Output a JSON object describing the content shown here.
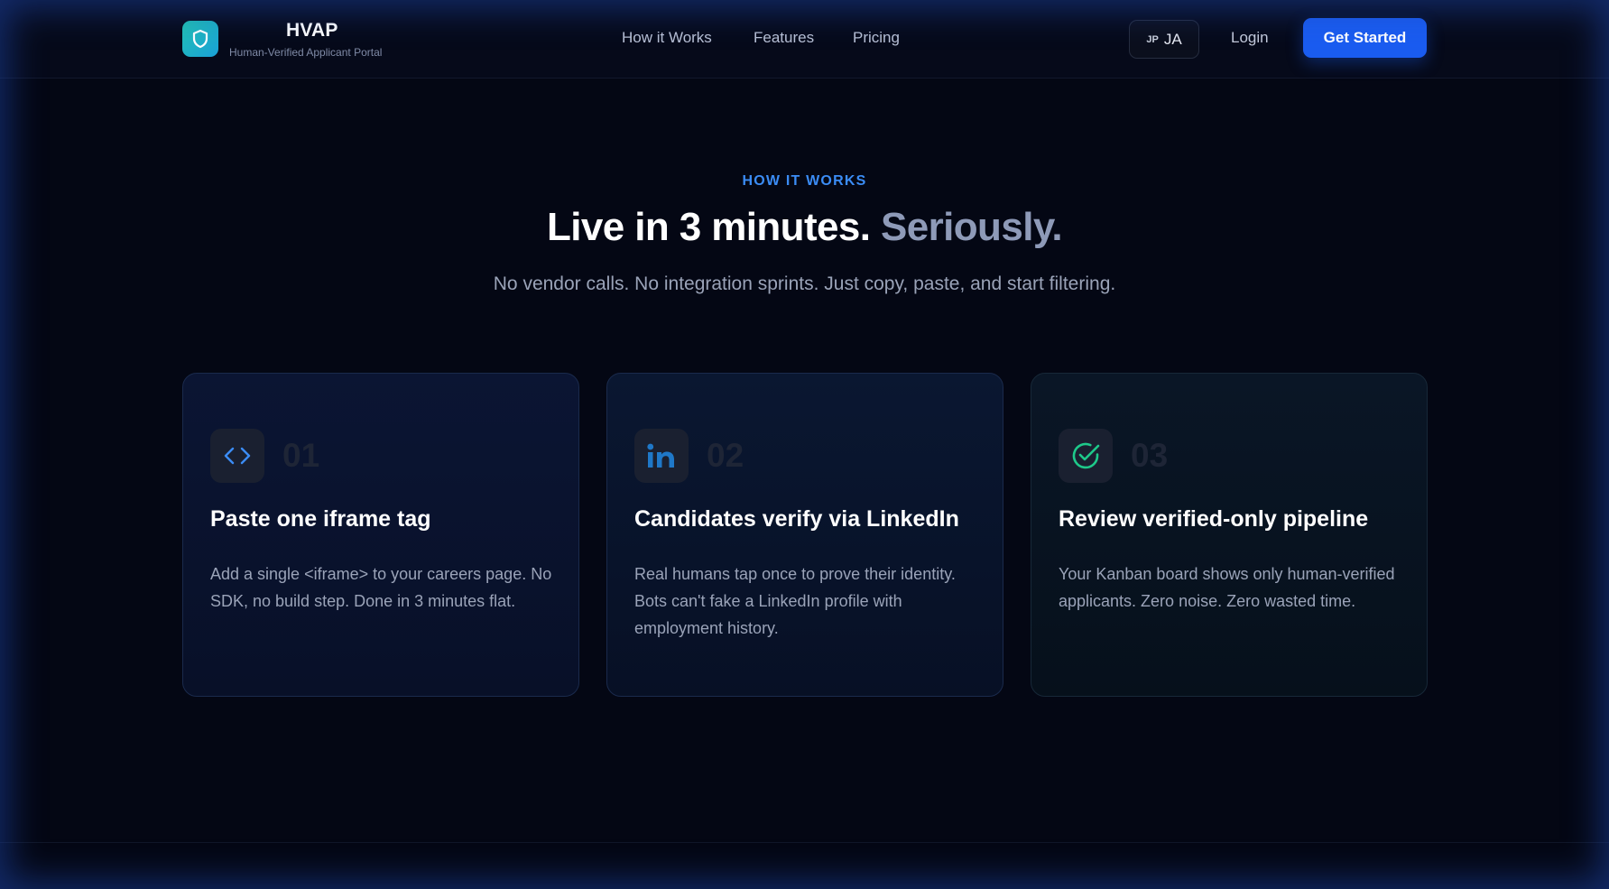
{
  "header": {
    "brand_name": "HVAP",
    "brand_sub": "Human-Verified Applicant Portal",
    "nav": [
      "How it Works",
      "Features",
      "Pricing"
    ],
    "lang_flag": "JP",
    "lang_code": "JA",
    "login": "Login",
    "cta": "Get Started"
  },
  "section": {
    "eyebrow": "HOW IT WORKS",
    "headline_main": "Live in 3 minutes.",
    "headline_accent": "Seriously.",
    "subline": "No vendor calls. No integration sprints. Just copy, paste, and start filtering."
  },
  "steps": [
    {
      "number": "01",
      "icon": "code-icon",
      "title": "Paste one iframe tag",
      "body": "Add a single <iframe> to your careers page. No SDK, no build step. Done in 3 minutes flat."
    },
    {
      "number": "02",
      "icon": "linkedin-icon",
      "title": "Candidates verify via LinkedIn",
      "body": "Real humans tap once to prove their identity. Bots can't fake a LinkedIn profile with employment history."
    },
    {
      "number": "03",
      "icon": "check-circle-icon",
      "title": "Review verified-only pipeline",
      "body": "Your Kanban board shows only human-verified applicants. Zero noise. Zero wasted time."
    }
  ],
  "colors": {
    "accent_blue": "#1a5cf0",
    "eyebrow_blue": "#3b8cf5",
    "linkedin_blue": "#1f78c8",
    "check_green": "#1ec98a",
    "logo_teal": "#22c3b3"
  }
}
